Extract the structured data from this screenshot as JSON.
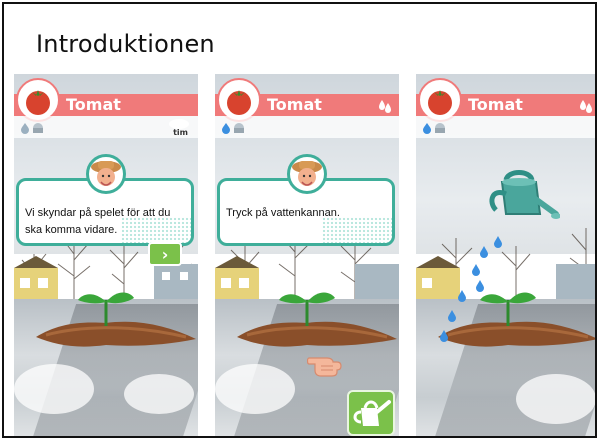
{
  "page": {
    "title": "Introduktionen"
  },
  "panels": [
    {
      "plant_name": "Tomat",
      "dialog_text": "Vi skyndar på spelet för att du ska komma vidare.",
      "status_label": "tim",
      "next_glyph": "›"
    },
    {
      "plant_name": "Tomat",
      "dialog_text": "Tryck på vattenkannan."
    },
    {
      "plant_name": "Tomat"
    }
  ],
  "icons": {
    "badge": "tomato-icon",
    "water": "water-drop-icon",
    "avatar": "farmer-avatar-icon",
    "next": "chevron-right-icon",
    "can": "watering-can-icon",
    "hand": "pointing-hand-icon"
  },
  "colors": {
    "header": "#f07a7a",
    "dialog_border": "#3fae9a",
    "button_green": "#7bc14a",
    "drop_blue": "#3b8fe0"
  }
}
